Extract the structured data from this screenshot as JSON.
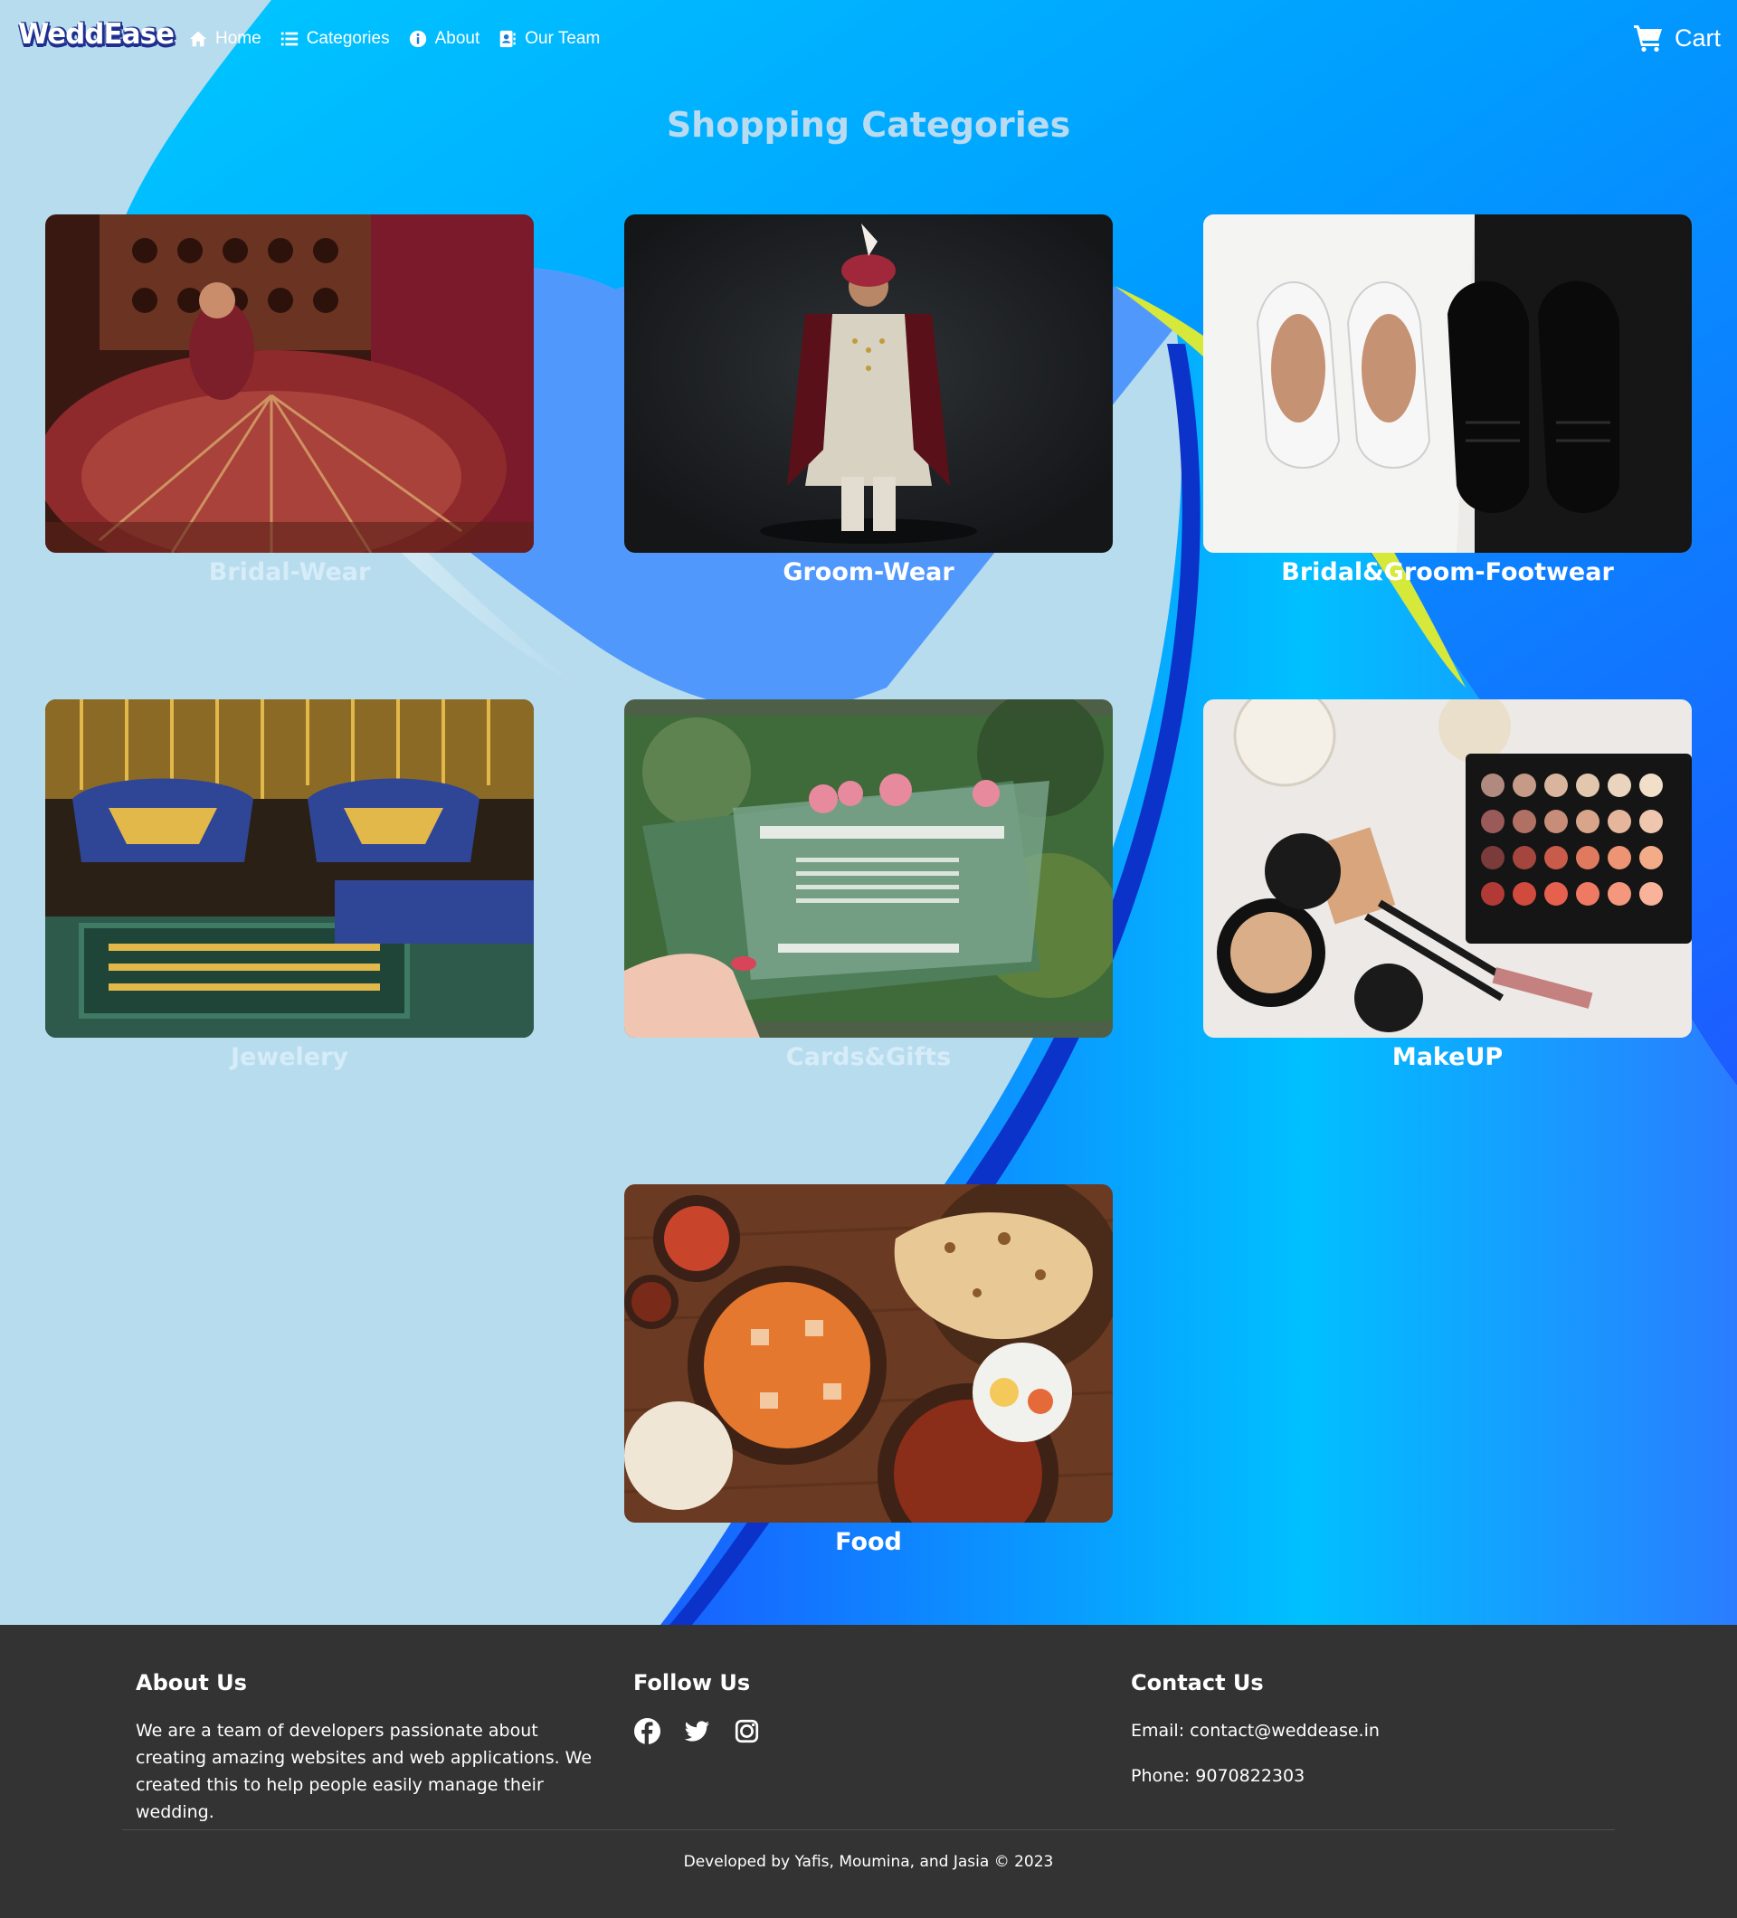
{
  "brand": {
    "logo_text": "WeddEase"
  },
  "nav": {
    "links": [
      {
        "label": "Home",
        "icon": "home-icon"
      },
      {
        "label": "Categories",
        "icon": "list-icon"
      },
      {
        "label": "About",
        "icon": "info-icon"
      },
      {
        "label": "Our Team",
        "icon": "address-book-icon"
      }
    ],
    "cart_label": "Cart",
    "cart_icon": "shopping-cart-icon"
  },
  "main": {
    "title": "Shopping Categories",
    "categories": [
      {
        "label": "Bridal-Wear"
      },
      {
        "label": "Groom-Wear"
      },
      {
        "label": "Bridal&Groom-Footwear"
      },
      {
        "label": "Jewelery"
      },
      {
        "label": "Cards&Gifts"
      },
      {
        "label": "MakeUP"
      },
      {
        "label": "Food"
      }
    ]
  },
  "footer": {
    "about": {
      "heading": "About Us",
      "text": "We are a team of developers passionate about creating amazing websites and web applications. We created this to help people easily manage their wedding."
    },
    "follow": {
      "heading": "Follow Us",
      "icons": [
        "facebook-icon",
        "twitter-icon",
        "instagram-icon"
      ]
    },
    "contact": {
      "heading": "Contact Us",
      "email": "Email: contact@weddease.in",
      "phone": "Phone: 9070822303"
    },
    "copyright": "Developed by Yafis, Moumina, and Jasia © 2023"
  },
  "colors": {
    "background_light": "#b7dcee",
    "accent_blue": "#00b8ff",
    "deep_blue": "#1d5cff",
    "footer_bg": "#333333",
    "logo_shadow": "#1e2f8f",
    "title_color": "#b9dbf2"
  }
}
